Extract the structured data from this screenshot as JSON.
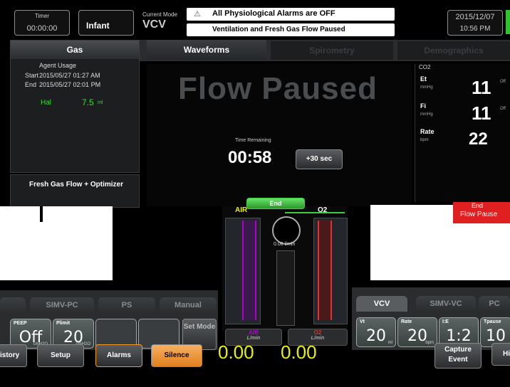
{
  "topbar": {
    "timer_label": "Timer",
    "timer_value": "00:00:00",
    "patient_mode": "Infant",
    "current_mode_label": "Current Mode",
    "current_mode": "VCV",
    "alarm_primary": "All Physiological Alarms are OFF",
    "alarm_secondary": "Ventilation and Fresh Gas Flow Paused",
    "date": "2015/12/07",
    "time": "10:56 PM"
  },
  "gas_panel": {
    "title": "Gas",
    "agent_usage_label": "Agent Usage",
    "start_label": "Start",
    "start_value": "2015/05/27 01:27 AM",
    "end_label": "End",
    "end_value": "2015/05/27 02:01 PM",
    "agent_name": "Hal",
    "agent_amount": "7.5",
    "agent_unit": "ml"
  },
  "fresh_gas": {
    "title": "Fresh Gas Flow + Optimizer"
  },
  "tabs": [
    {
      "label": "Waveforms"
    },
    {
      "label": "Spirometry"
    },
    {
      "label": "Demographics"
    }
  ],
  "main": {
    "flow_paused": "Flow Paused",
    "time_remaining_label": "Time Remaining",
    "time_remaining_value": "00:58",
    "add_time_button": "+30 sec",
    "end_button": "End",
    "end_pause_text_1": "End",
    "end_pause_text_2": "Flow Pause"
  },
  "vitals": {
    "header": "CO2",
    "rows": [
      {
        "label": "Et",
        "unit": "mmHg",
        "value": "11",
        "extra": "Off"
      },
      {
        "label": "Fi",
        "unit": "mmHg",
        "value": "11",
        "extra": "Off"
      },
      {
        "label": "Rate",
        "unit": "bpm",
        "value": "22",
        "extra": ""
      }
    ]
  },
  "flowmeters": {
    "air_label": "AIR",
    "o2_label": "O2",
    "total_flow": "0.00 l/min",
    "air_unit": "L/min",
    "o2_unit": "L/min",
    "air_value": "0.00",
    "o2_value": "0.00"
  },
  "left_modes": {
    "tabs": [
      "SIMV-PC",
      "PS",
      "Manual"
    ],
    "settings": [
      {
        "label": "PEEP",
        "value": "Off",
        "unit": "cmH2O"
      },
      {
        "label": "Plimit",
        "value": "20",
        "unit": "cmH2O"
      }
    ],
    "set_mode_label": "Set Mode"
  },
  "right_modes": {
    "tabs": [
      "VCV",
      "SIMV-VC",
      "PC"
    ],
    "settings": [
      {
        "label": "Vt",
        "value": "20",
        "unit": "ml"
      },
      {
        "label": "Rate",
        "value": "20",
        "unit": "bpm"
      },
      {
        "label": "I:E",
        "value": "1:2",
        "unit": ""
      },
      {
        "label": "Tpause",
        "value": "10",
        "unit": ""
      }
    ]
  },
  "bottombar": {
    "history": "History",
    "setup": "Setup",
    "alarms": "Alarms",
    "silence": "Silence",
    "capture_event": "Capture Event",
    "hi": "Hi"
  },
  "colors": {
    "flow_paused_text": "#4a4d50",
    "air": "#b000d0",
    "o2": "#e03030",
    "green_value": "#e8f000",
    "silence": "#f29a30",
    "end_green": "#3bd03b",
    "end_flow_pause": "#e02020"
  }
}
